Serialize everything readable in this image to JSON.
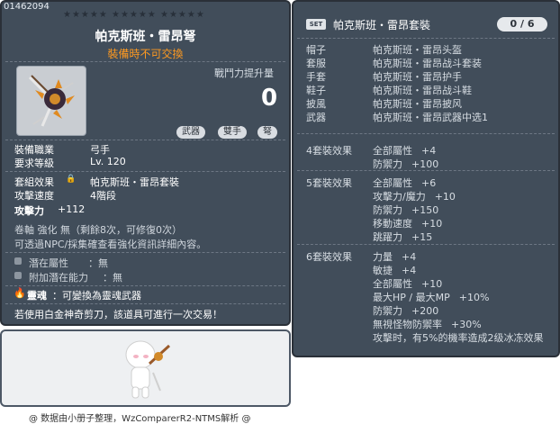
{
  "left": {
    "code": "01462094",
    "stars": "★★★★★ ★★★★★ ★★★★★",
    "title": "帕克斯班・雷昂弩",
    "subtitle": "裝備時不可交換",
    "power_label": "戰鬥力提升量",
    "power_value": "0",
    "tags": [
      "武器",
      "雙手",
      "弩"
    ],
    "rows": [
      {
        "label": "裝備職業",
        "value": "弓手"
      },
      {
        "label": "要求等級",
        "value": "Lv. 120"
      }
    ],
    "set_label": "套組效果",
    "set_value": "帕克斯班・雷昂套裝",
    "speed_label": "攻擊速度",
    "speed_value": "4階段",
    "atk_label": "攻擊力",
    "atk_value": "+112",
    "scroll_line": "卷軸 強化 無（剩餘8次，可修復0次）",
    "npc_line": "可透過NPC/採集確查看強化資訊詳細內容。",
    "potential_label": "潛在屬性",
    "potential_value": "：無",
    "addpot_label": "附加潛在能力",
    "addpot_value": "：無",
    "soul_label": "靈魂",
    "soul_value": "：可變換為靈魂武器",
    "scissors_line": "若使用白金神奇剪刀，該道具可進行一次交易！"
  },
  "right": {
    "set_badge": "SET",
    "set_title": "帕克斯班・雷昂套裝",
    "set_count": "0 / 6",
    "parts": [
      {
        "slot": "帽子",
        "name": "帕克斯班・雷昂头盔"
      },
      {
        "slot": "套服",
        "name": "帕克斯班・雷昂战斗套装"
      },
      {
        "slot": "手套",
        "name": "帕克斯班・雷昂护手"
      },
      {
        "slot": "鞋子",
        "name": "帕克斯班・雷昂战斗鞋"
      },
      {
        "slot": "披風",
        "name": "帕克斯班・雷昂披风"
      },
      {
        "slot": "武器",
        "name": "帕克斯班・雷昂武器中选1"
      }
    ],
    "effects": [
      {
        "title": "4套裝效果",
        "lines": [
          {
            "stat": "全部屬性",
            "val": "+4"
          },
          {
            "stat": "防禦力",
            "val": "+100"
          }
        ]
      },
      {
        "title": "5套裝效果",
        "lines": [
          {
            "stat": "全部屬性",
            "val": "+6"
          },
          {
            "stat": "攻擊力/魔力",
            "val": "+10"
          },
          {
            "stat": "防禦力",
            "val": "+150"
          },
          {
            "stat": "移動速度",
            "val": "+10"
          },
          {
            "stat": "跳躍力",
            "val": "+15"
          }
        ]
      },
      {
        "title": "6套裝效果",
        "lines": [
          {
            "stat": "力量",
            "val": "+4"
          },
          {
            "stat": "敏捷",
            "val": "+4"
          },
          {
            "stat": "全部屬性",
            "val": "+10"
          },
          {
            "stat": "最大HP / 最大MP",
            "val": "+10%"
          },
          {
            "stat": "防禦力",
            "val": "+200"
          },
          {
            "stat": "無視怪物防禦率",
            "val": "+30%"
          },
          {
            "stat": "攻擊时，有5%的機率造成2级冰冻效果",
            "val": ""
          }
        ]
      }
    ]
  },
  "footer": "@ 数据由小册子整理，WzComparerR2-NTMS解析 @",
  "colors": {
    "panel_bg": "#414d5a",
    "subtitle": "#ff9a20",
    "green": "#7fe07f"
  }
}
